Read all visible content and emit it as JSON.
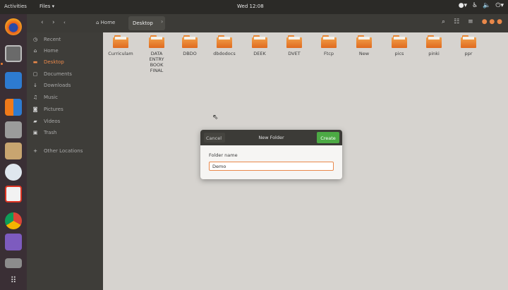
{
  "topbar": {
    "activities": "Activities",
    "app_menu": "Files ▾",
    "clock": "Wed 12:08"
  },
  "headerbar": {
    "home_label": "Home",
    "current_folder": "Desktop"
  },
  "sidebar": {
    "items": [
      {
        "label": "Recent",
        "icon": "clock-icon"
      },
      {
        "label": "Home",
        "icon": "home-icon"
      },
      {
        "label": "Desktop",
        "icon": "desktop-folder-icon",
        "active": true
      },
      {
        "label": "Documents",
        "icon": "documents-icon"
      },
      {
        "label": "Downloads",
        "icon": "downloads-icon"
      },
      {
        "label": "Music",
        "icon": "music-icon"
      },
      {
        "label": "Pictures",
        "icon": "pictures-icon"
      },
      {
        "label": "Videos",
        "icon": "videos-icon"
      },
      {
        "label": "Trash",
        "icon": "trash-icon"
      },
      {
        "label": "Other Locations",
        "icon": "plus-icon"
      }
    ]
  },
  "folders": [
    {
      "name": "Curriculam"
    },
    {
      "name": "DATA ENTRY BOOK FINAL"
    },
    {
      "name": "DBDO"
    },
    {
      "name": "dbdodocs"
    },
    {
      "name": "DEEK"
    },
    {
      "name": "DVET"
    },
    {
      "name": "Ftcp"
    },
    {
      "name": "New"
    },
    {
      "name": "pics"
    },
    {
      "name": "pinki"
    },
    {
      "name": "ppr"
    }
  ],
  "dialog": {
    "cancel_label": "Cancel",
    "title": "New Folder",
    "create_label": "Create",
    "field_label": "Folder name",
    "field_value": "Demo"
  },
  "colors": {
    "accent": "#e9884a",
    "create_button": "#4caa44",
    "folder": "#e7842f"
  }
}
